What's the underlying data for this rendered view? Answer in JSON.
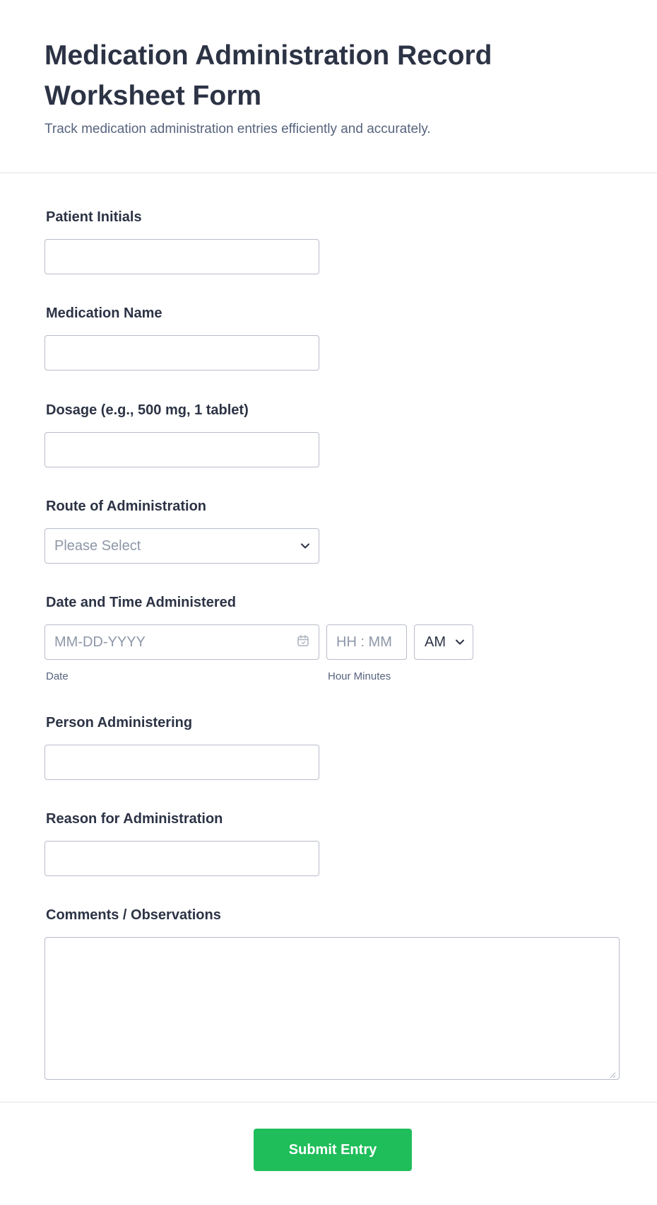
{
  "header": {
    "title": "Medication Administration Record Worksheet Form",
    "subtitle": "Track medication administration entries efficiently and accurately."
  },
  "fields": {
    "patient_initials": {
      "label": "Patient Initials",
      "value": ""
    },
    "medication_name": {
      "label": "Medication Name",
      "value": ""
    },
    "dosage": {
      "label": "Dosage (e.g., 500 mg, 1 tablet)",
      "value": ""
    },
    "route": {
      "label": "Route of Administration",
      "placeholder": "Please Select"
    },
    "datetime": {
      "label": "Date and Time Administered",
      "date_placeholder": "MM-DD-YYYY",
      "date_sublabel": "Date",
      "time_placeholder": "HH : MM",
      "time_sublabel": "Hour Minutes",
      "ampm_value": "AM"
    },
    "person_administering": {
      "label": "Person Administering",
      "value": ""
    },
    "reason": {
      "label": "Reason for Administration",
      "value": ""
    },
    "comments": {
      "label": "Comments / Observations",
      "value": ""
    }
  },
  "submit": {
    "label": "Submit Entry"
  },
  "icons": {
    "calendar": "calendar-icon",
    "chevron": "chevron-down-icon",
    "resize": "resize-grip-icon"
  },
  "colors": {
    "accent": "#1fbe5b",
    "text": "#2c3345",
    "muted": "#57647e",
    "placeholder": "#8d97a8",
    "border": "#b8bdc9"
  }
}
